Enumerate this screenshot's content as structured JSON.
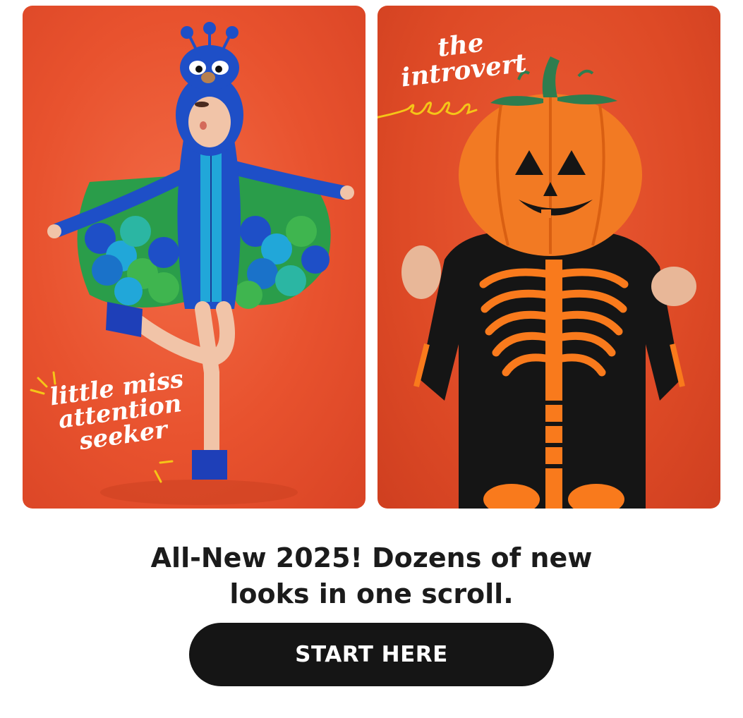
{
  "cards": [
    {
      "label_lines": [
        "little miss",
        "attention",
        "seeker"
      ],
      "illustration": "peacock-costume-photo",
      "background_color": "#e8522e"
    },
    {
      "label_lines": [
        "the",
        "introvert"
      ],
      "illustration": "pumpkin-skeleton-costume-photo",
      "background_color": "#de4a26"
    }
  ],
  "headline": {
    "line1": "All-New 2025! Dozens of new",
    "line2": "looks in one scroll."
  },
  "cta": {
    "label": "START HERE",
    "background_color": "#151515"
  },
  "colors": {
    "accent_orange": "#f97a1c",
    "accent_yellow": "#f5c518",
    "peacock_blue": "#1e4fc7"
  }
}
